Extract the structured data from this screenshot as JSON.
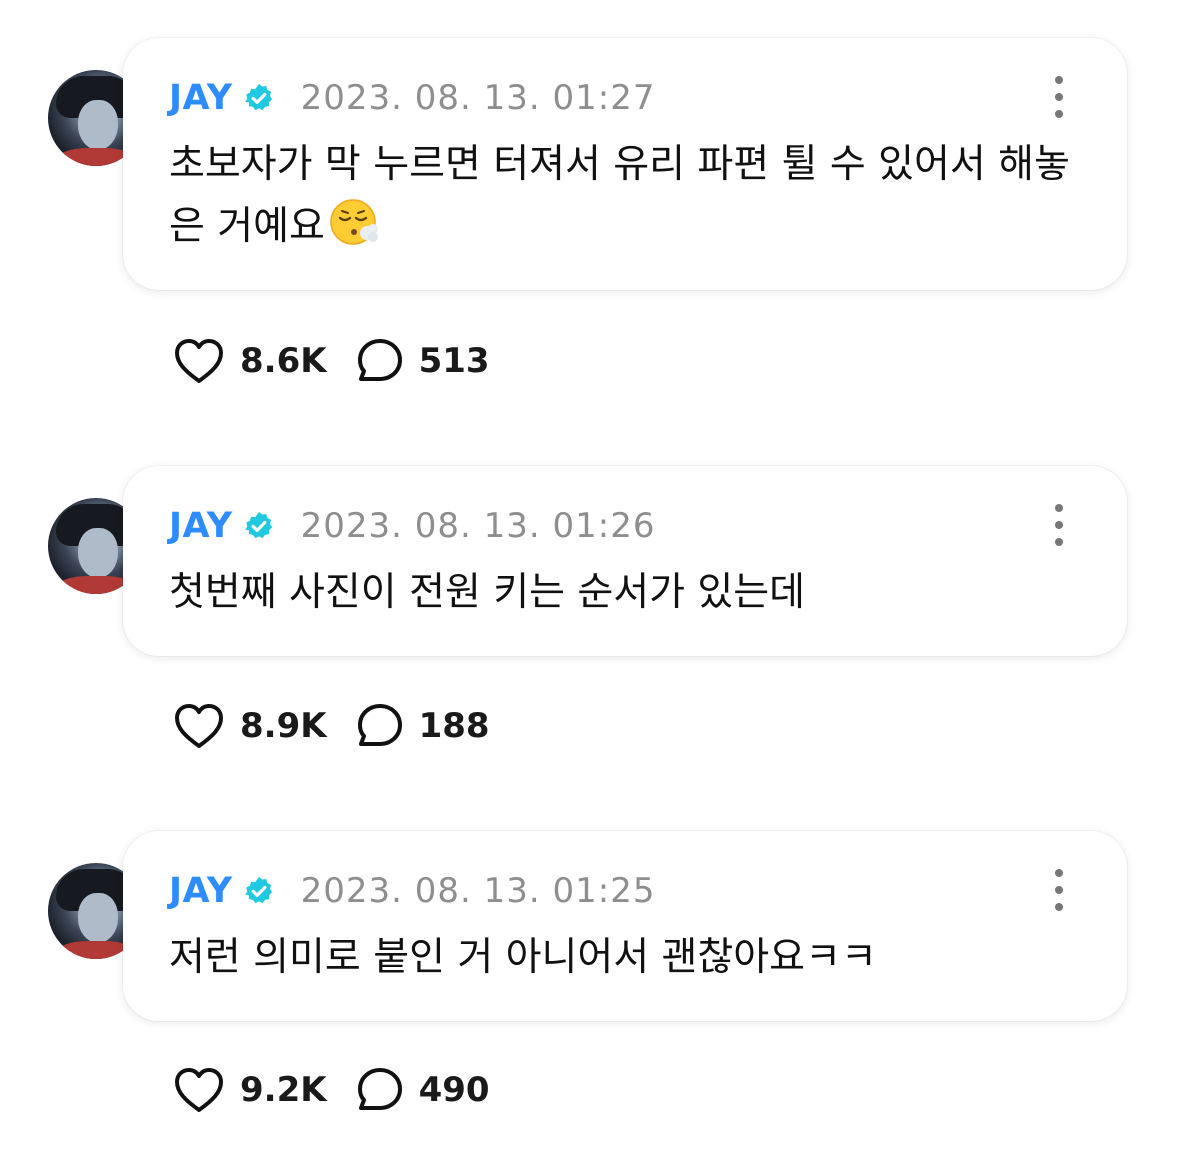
{
  "posts": [
    {
      "author": "JAY",
      "timestamp": "2023. 08. 13. 01:27",
      "text": "초보자가 막 누르면 터져서 유리 파편 튈 수 있어서 해놓은 거예요",
      "emoji": "face-exhaling-emoji",
      "likes": "8.6K",
      "comments": "513"
    },
    {
      "author": "JAY",
      "timestamp": "2023. 08. 13. 01:26",
      "text": "첫번째 사진이 전원 키는 순서가 있는데",
      "likes": "8.9K",
      "comments": "188"
    },
    {
      "author": "JAY",
      "timestamp": "2023. 08. 13. 01:25",
      "text": "저런 의미로 붙인 거 아니어서 괜찮아요ㅋㅋ",
      "likes": "9.2K",
      "comments": "490"
    }
  ],
  "colors": {
    "author": "#2d8cff",
    "verified_badge": "#20c9e0",
    "timestamp": "#8e8e8e",
    "text": "#111111"
  },
  "icons": [
    "verified-badge-icon",
    "more-options-icon",
    "heart-icon",
    "comment-bubble-icon"
  ]
}
